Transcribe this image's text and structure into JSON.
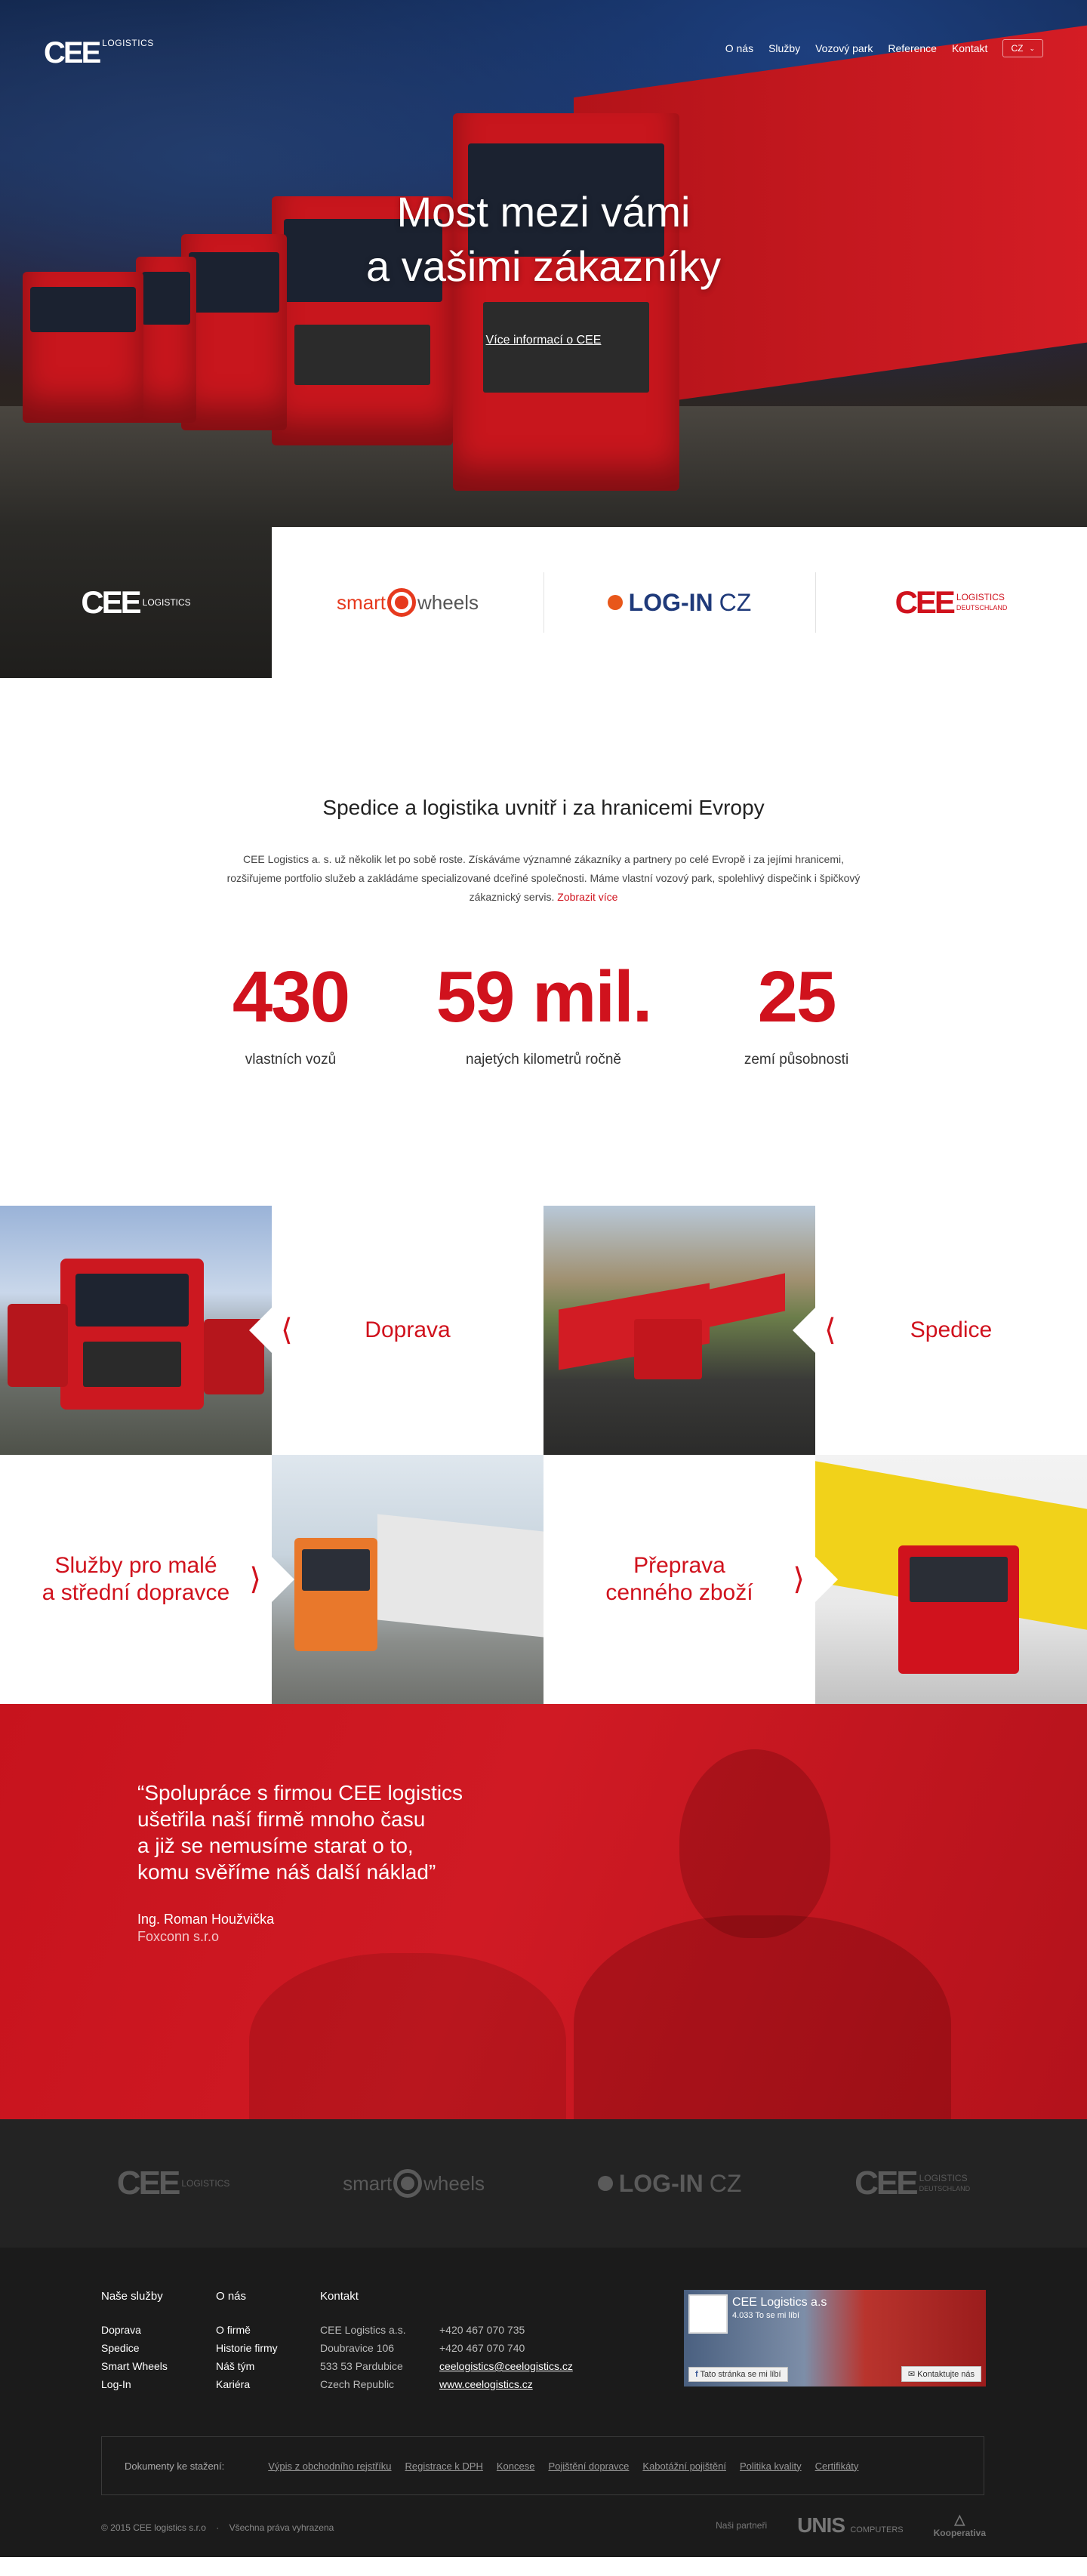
{
  "nav": {
    "logo_main": "CEE",
    "logo_sub": "LOGISTICS",
    "items": [
      {
        "label": "O nás"
      },
      {
        "label": "Služby"
      },
      {
        "label": "Vozový park"
      },
      {
        "label": "Reference"
      },
      {
        "label": "Kontakt"
      }
    ],
    "lang": "CZ"
  },
  "hero": {
    "title_line1": "Most mezi vámi",
    "title_line2": "a vašimi zákazníky",
    "cta": "Více informací o CEE"
  },
  "brands": {
    "cee_main": "CEE",
    "cee_sub": "LOGISTICS",
    "smart_a": "smart",
    "smart_b": "wheels",
    "login": "LOG-IN",
    "login_cz": "CZ",
    "ceede_main": "CEE",
    "ceede_sub1": "LOGISTICS",
    "ceede_sub2": "DEUTSCHLAND"
  },
  "intro": {
    "heading": "Spedice a logistika uvnitř i za hranicemi Evropy",
    "text": "CEE Logistics a. s. už několik let po sobě roste. Získáváme významné zákazníky a partnery po celé Evropě i za jejími hranicemi, rozšiřujeme portfolio služeb a zakládáme specializované dceřiné společnosti. Máme vlastní vozový park, spolehlivý dispečink i špičkový zákaznický servis. ",
    "link": "Zobrazit více"
  },
  "stats": [
    {
      "value": "430",
      "label": "vlastních vozů"
    },
    {
      "value": "59 mil.",
      "label": "najetých kilometrů ročně"
    },
    {
      "value": "25",
      "label": "zemí působnosti"
    }
  ],
  "services": {
    "doprava": "Doprava",
    "spedice": "Spedice",
    "male_1": "Služby pro malé",
    "male_2": "a střední dopravce",
    "cenne_1": "Přeprava",
    "cenne_2": "cenného zboží"
  },
  "quote": {
    "line1": "“Spolupráce s firmou CEE logistics",
    "line2": "ušetřila naší firmě mnoho času",
    "line3": "a již se nemusíme starat o to,",
    "line4": "komu svěříme náš další náklad”",
    "author": "Ing. Roman Houžvička",
    "company": "Foxconn s.r.o"
  },
  "partners": {
    "cee_main": "CEE",
    "cee_sub": "LOGISTICS",
    "smart_a": "smart",
    "smart_b": "wheels",
    "login": "LOG-IN",
    "login_cz": "CZ",
    "ceede_main": "CEE",
    "ceede_sub1": "LOGISTICS",
    "ceede_sub2": "DEUTSCHLAND"
  },
  "footer": {
    "col1": {
      "title": "Naše služby",
      "items": [
        "Doprava",
        "Spedice",
        "Smart Wheels",
        "Log-In"
      ]
    },
    "col2": {
      "title": "O nás",
      "items": [
        "O firmě",
        "Historie firmy",
        "Náš tým",
        "Kariéra"
      ]
    },
    "col3": {
      "title": "Kontakt",
      "items": [
        "CEE Logistics a.s.",
        "Doubravice 106",
        "533 53 Pardubice",
        "Czech Republic"
      ]
    },
    "col4": {
      "items": [
        "+420 467 070 735",
        "+420 467 070 740",
        "ceelogistics@ceelogistics.cz",
        "www.ceelogistics.cz"
      ]
    },
    "fb": {
      "title": "CEE Logistics a.s",
      "likes": "4.033 To se mi líbí",
      "like_btn": "Tato stránka se mi líbí",
      "contact_btn": "Kontaktujte nás"
    },
    "docs": {
      "lead": "Dokumenty ke stažení:",
      "links": [
        "Výpis z obchodního rejstříku",
        "Registrace k DPH",
        "Koncese",
        "Pojištění dopravce",
        "Kabotážní pojištění",
        "Politika kvality",
        "Certifikáty"
      ]
    },
    "copy": "© 2015 CEE logistics s.r.o    ·    Všechna práva vyhrazena",
    "partners_label": "Naši partneři",
    "unis": "UNIS",
    "unis_sub": "COMPUTERS",
    "koop": "Kooperativa"
  }
}
